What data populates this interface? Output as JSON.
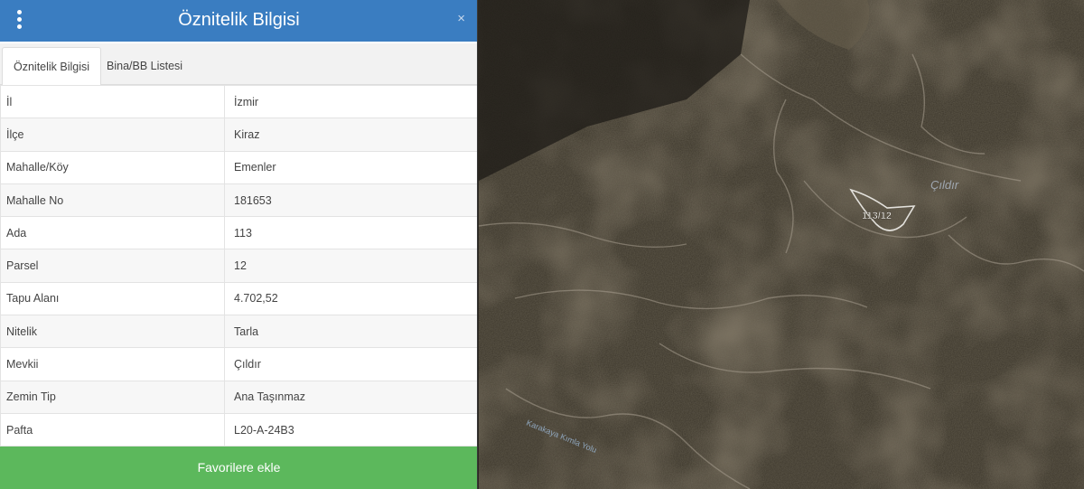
{
  "header": {
    "title": "Öznitelik Bilgisi",
    "close_label": "×",
    "menu_icon": "vertical-dots-icon"
  },
  "tabs": [
    {
      "label": "Öznitelik Bilgisi",
      "active": true
    },
    {
      "label": "Bina/BB Listesi",
      "active": false
    }
  ],
  "attributes": [
    {
      "key": "İl",
      "value": "İzmir"
    },
    {
      "key": "İlçe",
      "value": "Kiraz"
    },
    {
      "key": "Mahalle/Köy",
      "value": "Emenler"
    },
    {
      "key": "Mahalle No",
      "value": "181653"
    },
    {
      "key": "Ada",
      "value": "113"
    },
    {
      "key": "Parsel",
      "value": "12"
    },
    {
      "key": "Tapu Alanı",
      "value": "4.702,52"
    },
    {
      "key": "Nitelik",
      "value": "Tarla"
    },
    {
      "key": "Mevkii",
      "value": "Çıldır"
    },
    {
      "key": "Zemin Tip",
      "value": "Ana Taşınmaz"
    },
    {
      "key": "Pafta",
      "value": "L20-A-24B3"
    }
  ],
  "footer": {
    "favorite_label": "Favorilere ekle"
  },
  "map": {
    "place_label": "Çıldır",
    "parcel_label": "113/12",
    "road_label": "Karakaya Kımla Yolu"
  },
  "colors": {
    "header": "#3a7dc1",
    "favorite": "#5cb85c"
  }
}
